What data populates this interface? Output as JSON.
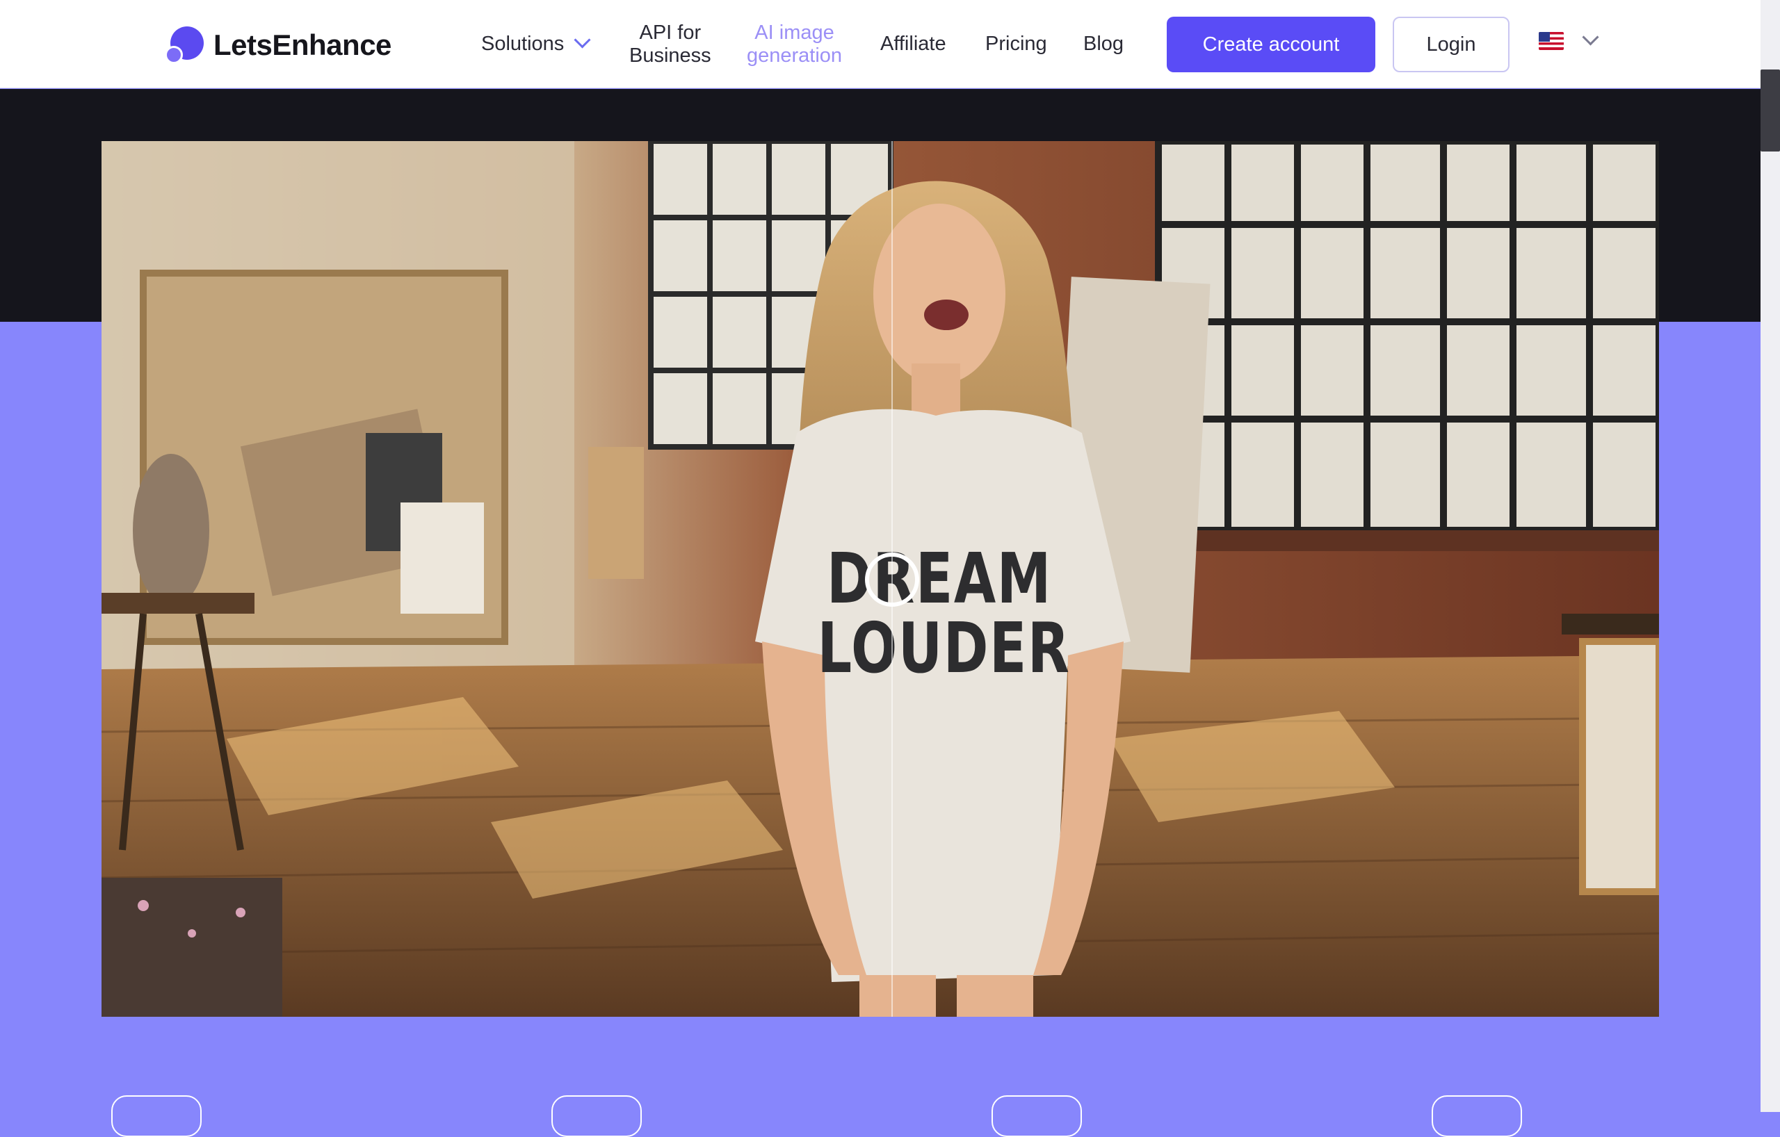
{
  "header": {
    "brand": "LetsEnhance",
    "nav": {
      "solutions": "Solutions",
      "api_line1": "API for",
      "api_line2": "Business",
      "ai_line1": "AI image",
      "ai_line2": "generation",
      "affiliate": "Affiliate",
      "pricing": "Pricing",
      "blog": "Blog"
    },
    "create_account": "Create account",
    "login": "Login",
    "language_flag": "us-flag-icon"
  },
  "hero_image": {
    "shirt_line1": "DREAM",
    "shirt_line2": "LOUDER"
  },
  "colors": {
    "accent": "#5a4cf6",
    "active_nav": "#9b8ff6",
    "band_dark": "#15151c",
    "band_purple": "#8786fc"
  }
}
